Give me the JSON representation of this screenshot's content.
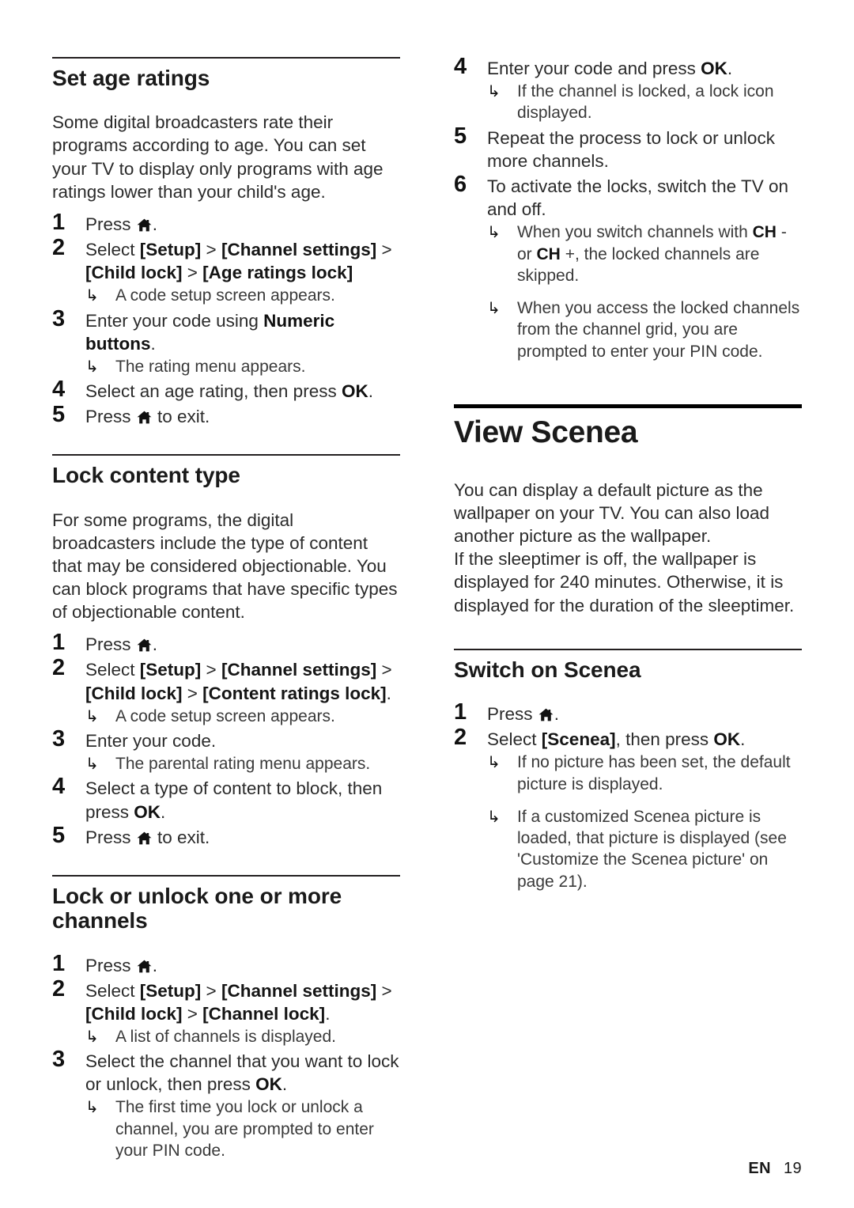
{
  "page": {
    "language_code": "EN",
    "page_number": "19",
    "home_icon_name": "home-icon",
    "arrow_bullet_glyph": "↳"
  },
  "left_column": {
    "sections": [
      {
        "title": "Set age ratings",
        "rule": "thin",
        "intro": "Some digital broadcasters rate their programs according to age. You can set your TV to display only programs with age ratings lower than your child's age.",
        "steps": [
          {
            "number": "1",
            "text_before": "Press ",
            "icon": "home-icon",
            "text_after": "."
          },
          {
            "number": "2",
            "text": "Select [Setup] > [Channel settings] > [Child lock] > [Age ratings lock]",
            "notes": [
              "A code setup screen appears."
            ]
          },
          {
            "number": "3",
            "text": "Enter your code using Numeric buttons.",
            "notes": [
              "The rating menu appears."
            ]
          },
          {
            "number": "4",
            "text": "Select an age rating, then press OK."
          },
          {
            "number": "5",
            "text_before": "Press ",
            "icon": "home-icon",
            "text_after": " to exit."
          }
        ]
      },
      {
        "title": "Lock content type",
        "rule": "thin",
        "intro": "For some programs, the digital broadcasters include the type of content that may be considered objectionable. You can block programs that have specific types of objectionable content.",
        "steps": [
          {
            "number": "1",
            "text_before": "Press ",
            "icon": "home-icon",
            "text_after": "."
          },
          {
            "number": "2",
            "text": "Select [Setup] > [Channel settings] > [Child lock] > [Content ratings lock].",
            "notes": [
              "A code setup screen appears."
            ]
          },
          {
            "number": "3",
            "text": "Enter your code.",
            "notes": [
              "The parental rating menu appears."
            ]
          },
          {
            "number": "4",
            "text": "Select a type of content to block, then press OK."
          },
          {
            "number": "5",
            "text_before": "Press ",
            "icon": "home-icon",
            "text_after": " to exit."
          }
        ]
      },
      {
        "title": "Lock or unlock one or more channels",
        "rule": "thin",
        "intro": "",
        "steps": [
          {
            "number": "1",
            "text_before": "Press ",
            "icon": "home-icon",
            "text_after": "."
          },
          {
            "number": "2",
            "text": "Select [Setup] > [Channel settings] > [Child lock] > [Channel lock].",
            "notes": [
              "A list of channels is displayed."
            ]
          },
          {
            "number": "3",
            "text": "Select the channel that you want to lock or unlock, then press OK.",
            "notes": [
              "The first time you lock or unlock a channel, you are prompted to enter your PIN code."
            ]
          }
        ]
      }
    ]
  },
  "right_column": {
    "continued_steps": [
      {
        "number": "4",
        "text": "Enter your code and press OK.",
        "notes": [
          "If the channel is locked, a lock icon displayed."
        ]
      },
      {
        "number": "5",
        "text": "Repeat the process to lock or unlock more channels."
      },
      {
        "number": "6",
        "text": "To activate the locks, switch the TV on and off.",
        "notes": [
          "When you switch channels with CH - or CH +, the locked channels are skipped.",
          "When you access the locked channels from the channel grid, you are prompted to enter your PIN code."
        ]
      }
    ],
    "chapter": {
      "title": "View Scenea",
      "rule": "thick",
      "paragraphs": [
        "You can display a default picture as the wallpaper on your TV. You can also load another picture as the wallpaper.",
        "If the sleeptimer is off, the wallpaper is displayed for 240 minutes. Otherwise, it is displayed for the duration of the sleeptimer."
      ]
    },
    "sections": [
      {
        "title": "Switch on Scenea",
        "rule": "thin",
        "steps": [
          {
            "number": "1",
            "text_before": "Press ",
            "icon": "home-icon",
            "text_after": "."
          },
          {
            "number": "2",
            "text": "Select [Scenea], then press OK.",
            "notes": [
              "If no picture has been set, the default picture is displayed.",
              "If a customized Scenea picture is loaded, that picture is displayed (see 'Customize the Scenea picture' on page 21)."
            ]
          }
        ]
      }
    ]
  }
}
